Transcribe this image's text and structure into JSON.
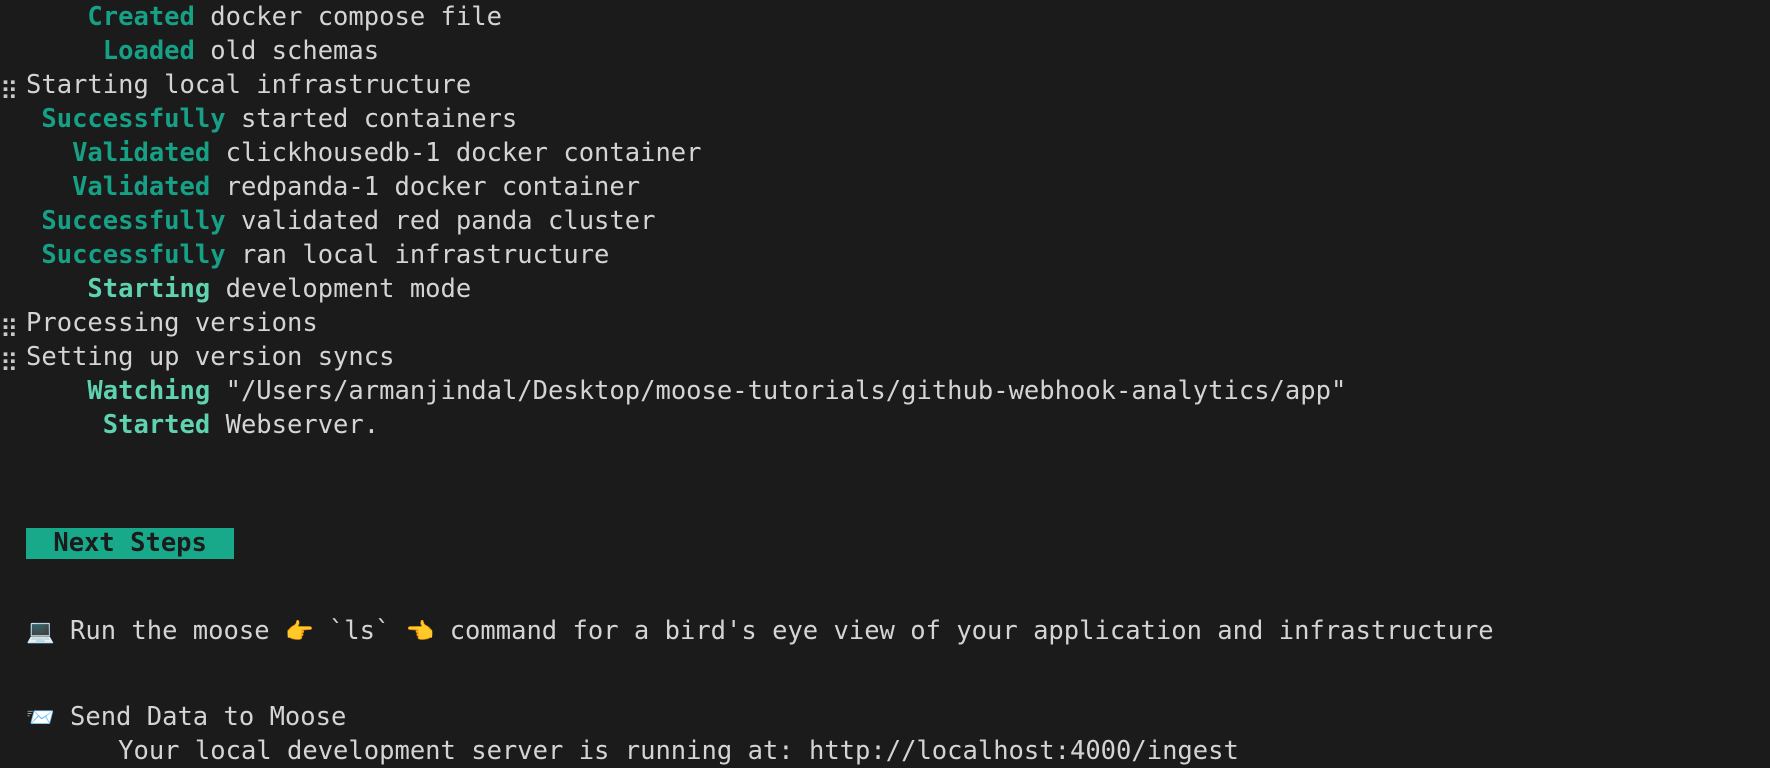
{
  "terminal": {
    "title": "moose dev output",
    "background_color": "#1b1b1b",
    "text_color": "#d4d4d4",
    "accent_color": "#16a085",
    "accent_light_color": "#5fd2b0",
    "badge_bg_color": "#18a88a",
    "badge_text_color": "#1b1b1b",
    "spinner_glyph": "⣶",
    "log_lines": [
      {
        "id": "line-clipped-top",
        "clipped": true,
        "spinner": false,
        "label": "",
        "message": ""
      },
      {
        "id": "line-created-docker-compose",
        "spinner": false,
        "label": "Created",
        "label_style": "accent",
        "indent": 4,
        "message": " docker compose file"
      },
      {
        "id": "line-loaded-old-schemas",
        "spinner": false,
        "label": "Loaded",
        "label_style": "accent",
        "indent": 5,
        "message": " old schemas"
      },
      {
        "id": "line-starting-local-infrastructure",
        "spinner": true,
        "label": "",
        "label_style": "none",
        "indent": 0,
        "message": "Starting local infrastructure"
      },
      {
        "id": "line-successfully-started-containers",
        "spinner": false,
        "label": "Successfully",
        "label_style": "accent",
        "indent": 1,
        "message": " started containers"
      },
      {
        "id": "line-validated-clickhousedb",
        "spinner": false,
        "label": "Validated",
        "label_style": "accent",
        "indent": 3,
        "message": " clickhousedb-1 docker container"
      },
      {
        "id": "line-validated-redpanda",
        "spinner": false,
        "label": "Validated",
        "label_style": "accent",
        "indent": 3,
        "message": " redpanda-1 docker container"
      },
      {
        "id": "line-successfully-validated-redpanda-cluster",
        "spinner": false,
        "label": "Successfully",
        "label_style": "accent",
        "indent": 1,
        "message": " validated red panda cluster"
      },
      {
        "id": "line-successfully-ran-local-infrastructure",
        "spinner": false,
        "label": "Successfully",
        "label_style": "accent",
        "indent": 1,
        "message": " ran local infrastructure"
      },
      {
        "id": "line-starting-development-mode",
        "spinner": false,
        "label": "Starting",
        "label_style": "accent-light",
        "indent": 4,
        "message": " development mode"
      },
      {
        "id": "line-processing-versions",
        "spinner": true,
        "label": "",
        "label_style": "none",
        "indent": 0,
        "message": "Processing versions"
      },
      {
        "id": "line-setting-up-version-syncs",
        "spinner": true,
        "label": "",
        "label_style": "none",
        "indent": 0,
        "message": "Setting up version syncs"
      },
      {
        "id": "line-watching-app-directory",
        "spinner": false,
        "label": "Watching",
        "label_style": "accent-light",
        "indent": 4,
        "message": " \"/Users/armanjindal/Desktop/moose-tutorials/github-webhook-analytics/app\""
      },
      {
        "id": "line-started-webserver",
        "spinner": false,
        "label": "Started",
        "label_style": "accent-light",
        "indent": 5,
        "message": " Webserver."
      }
    ],
    "next_steps": {
      "badge_label": " Next Steps ",
      "items": [
        {
          "id": "step-run-moose-ls",
          "icon": "laptop-emoji",
          "icon_glyph": "💻",
          "text_before": " Run the moose ",
          "pointer_right_glyph": "👉",
          "pointer_right_name": "pointing-right-emoji",
          "command": " `ls` ",
          "pointer_left_glyph": "👈",
          "pointer_left_name": "pointing-left-emoji",
          "text_after": " command for a bird's eye view of your application and infrastructure"
        },
        {
          "id": "step-send-data-to-moose",
          "icon": "inbox-tray-emoji",
          "icon_glyph": "📨",
          "title": " Send Data to Moose",
          "detail": "Your local development server is running at: http://localhost:4000/ingest",
          "detail_indent": 6
        }
      ]
    }
  }
}
